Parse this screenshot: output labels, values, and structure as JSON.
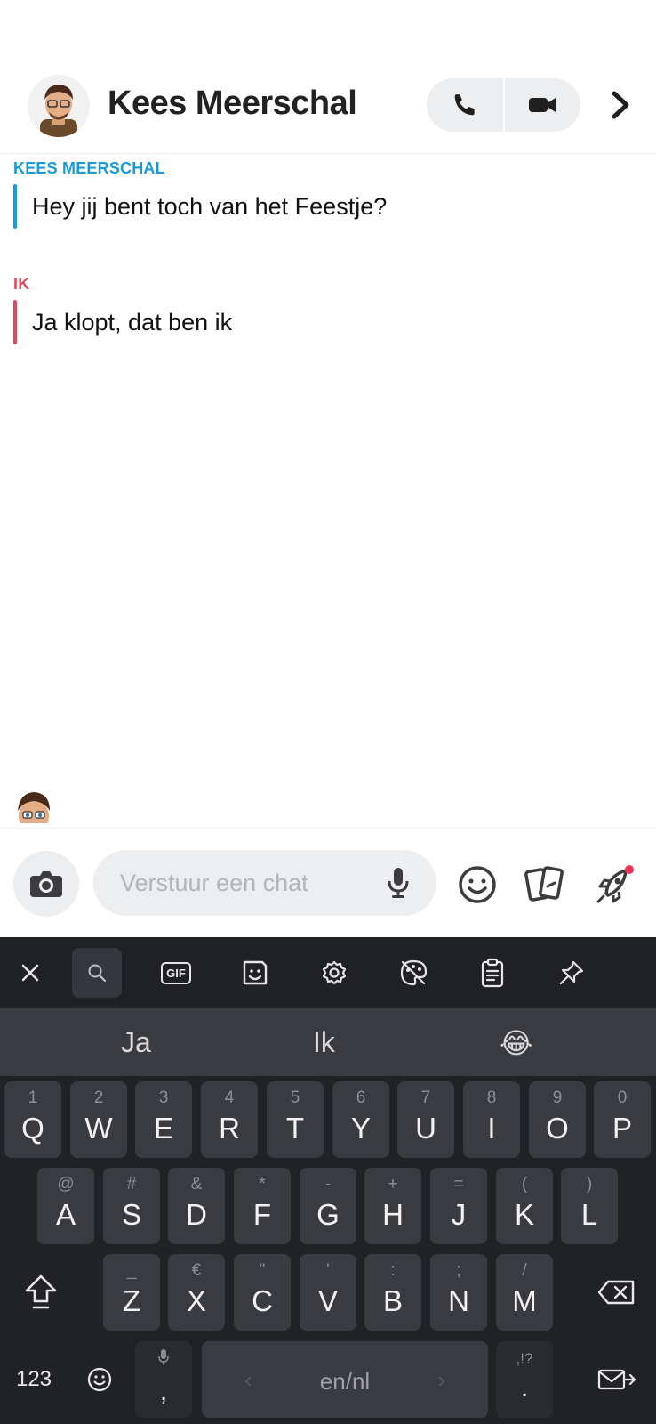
{
  "header": {
    "contact_name": "Kees Meerschal"
  },
  "messages": [
    {
      "sender": "KEES MEERSCHAL",
      "text": "Hey jij bent toch van het Feestje?",
      "color": "#1a9ad6"
    },
    {
      "sender": "IK",
      "text": "Ja klopt, dat ben ik",
      "color": "#e04a5f"
    }
  ],
  "composer": {
    "placeholder": "Verstuur een chat"
  },
  "keyboard": {
    "toolbar": {
      "gif_label": "GIF"
    },
    "suggestions": [
      "Ja",
      "Ik",
      "😂"
    ],
    "rows": [
      [
        {
          "k": "Q",
          "s": "1"
        },
        {
          "k": "W",
          "s": "2"
        },
        {
          "k": "E",
          "s": "3"
        },
        {
          "k": "R",
          "s": "4"
        },
        {
          "k": "T",
          "s": "5"
        },
        {
          "k": "Y",
          "s": "6"
        },
        {
          "k": "U",
          "s": "7"
        },
        {
          "k": "I",
          "s": "8"
        },
        {
          "k": "O",
          "s": "9"
        },
        {
          "k": "P",
          "s": "0"
        }
      ],
      [
        {
          "k": "A",
          "s": "@"
        },
        {
          "k": "S",
          "s": "#"
        },
        {
          "k": "D",
          "s": "&"
        },
        {
          "k": "F",
          "s": "*"
        },
        {
          "k": "G",
          "s": "-"
        },
        {
          "k": "H",
          "s": "+"
        },
        {
          "k": "J",
          "s": "="
        },
        {
          "k": "K",
          "s": "("
        },
        {
          "k": "L",
          "s": ")"
        }
      ],
      [
        {
          "k": "Z",
          "s": "_"
        },
        {
          "k": "X",
          "s": "€"
        },
        {
          "k": "C",
          "s": "\""
        },
        {
          "k": "V",
          "s": "'"
        },
        {
          "k": "B",
          "s": ":"
        },
        {
          "k": "N",
          "s": ";"
        },
        {
          "k": "M",
          "s": "/"
        }
      ]
    ],
    "bottom": {
      "numbers": "123",
      "comma": ",",
      "space_label": "en/nl",
      "period": ".",
      "punct_hint": ",!?"
    }
  }
}
